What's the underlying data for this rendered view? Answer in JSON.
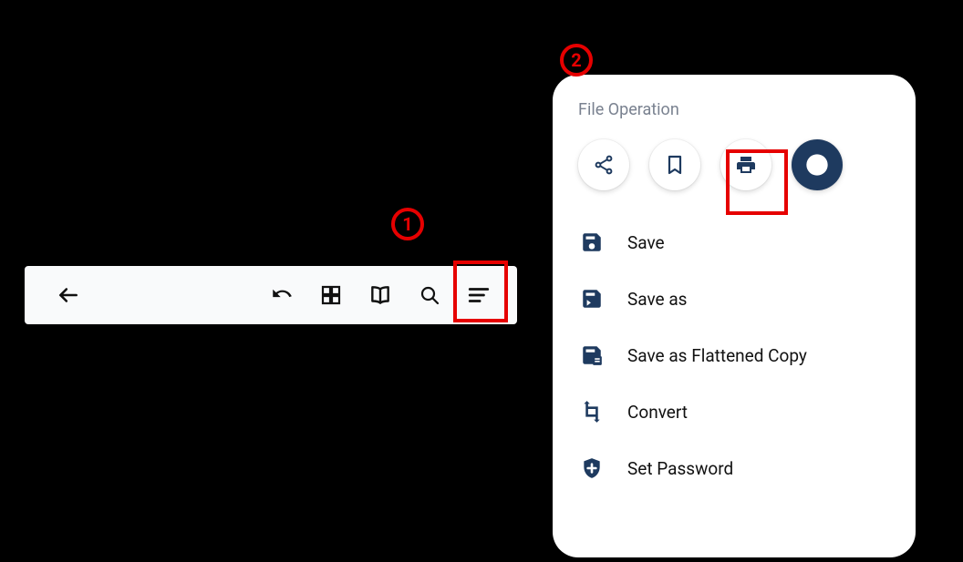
{
  "callouts": {
    "one": "1",
    "two": "2"
  },
  "panel": {
    "title": "File Operation",
    "actions": {
      "share": "share",
      "bookmark": "bookmark",
      "print": "print",
      "info": "info"
    },
    "items": [
      {
        "icon": "save",
        "label": "Save"
      },
      {
        "icon": "save-as",
        "label": "Save as"
      },
      {
        "icon": "save-flattened",
        "label": "Save as Flattened Copy"
      },
      {
        "icon": "convert",
        "label": "Convert"
      },
      {
        "icon": "set-password",
        "label": "Set Password"
      }
    ]
  }
}
